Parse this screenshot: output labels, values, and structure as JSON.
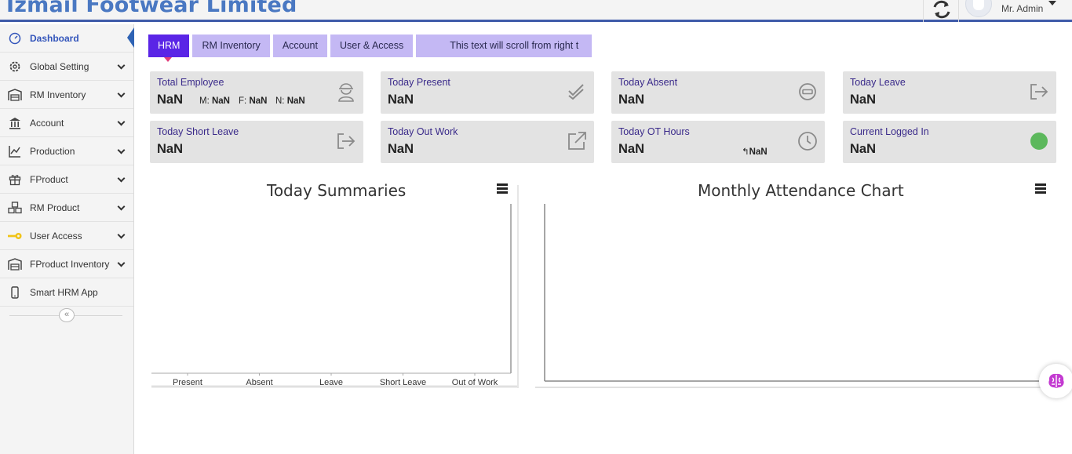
{
  "header": {
    "brand": "Izmail Footwear Limited",
    "user_name": "Mr. Admin"
  },
  "sidebar": {
    "items": [
      {
        "label": "Dashboard",
        "icon": "gauge-icon"
      },
      {
        "label": "Global Setting",
        "icon": "gear-icon"
      },
      {
        "label": "RM Inventory",
        "icon": "warehouse-icon"
      },
      {
        "label": "Account",
        "icon": "bank-icon"
      },
      {
        "label": "Production",
        "icon": "line-chart-icon"
      },
      {
        "label": "FProduct",
        "icon": "gift-icon"
      },
      {
        "label": "RM Product",
        "icon": "cubes-icon"
      },
      {
        "label": "User Access",
        "icon": "key-icon"
      },
      {
        "label": "FProduct Inventory",
        "icon": "warehouse-icon"
      },
      {
        "label": "Smart HRM App",
        "icon": "mobile-icon"
      }
    ],
    "collapse_glyph": "«"
  },
  "tabs": [
    "HRM",
    "RM Inventory",
    "Account",
    "User & Access"
  ],
  "ticker_text": "This text will scroll from right t",
  "cards": {
    "total_employee": {
      "title": "Total Employee",
      "value": "NaN",
      "m_label": "M:",
      "m_value": "NaN",
      "f_label": "F:",
      "f_value": "NaN",
      "n_label": "N:",
      "n_value": "NaN"
    },
    "today_present": {
      "title": "Today Present",
      "value": "NaN"
    },
    "today_absent": {
      "title": "Today Absent",
      "value": "NaN"
    },
    "today_leave": {
      "title": "Today Leave",
      "value": "NaN"
    },
    "today_short_leave": {
      "title": "Today Short Leave",
      "value": "NaN"
    },
    "today_out_work": {
      "title": "Today Out Work",
      "value": "NaN"
    },
    "today_ot_hours": {
      "title": "Today OT Hours",
      "value": "NaN",
      "sub_prefix": "↰",
      "sub_value": "NaN"
    },
    "current_logged_in": {
      "title": "Current Logged In",
      "value": "NaN"
    }
  },
  "colors": {
    "accent_tab": "#5a25e6",
    "tab_bg": "#c4b8f4",
    "card_bg": "#e3e3e3",
    "online_dot": "#5cb85c",
    "brand": "#4a78c2"
  },
  "chart_data": [
    {
      "type": "bar",
      "title": "Today Summaries",
      "categories": [
        "Present",
        "Absent",
        "Leave",
        "Short Leave",
        "Out of Work"
      ],
      "values": [
        null,
        null,
        null,
        null,
        null
      ],
      "xlabel": "",
      "ylabel": ""
    },
    {
      "type": "bar",
      "title": "Monthly Attendance Chart",
      "categories": [],
      "values": []
    }
  ]
}
